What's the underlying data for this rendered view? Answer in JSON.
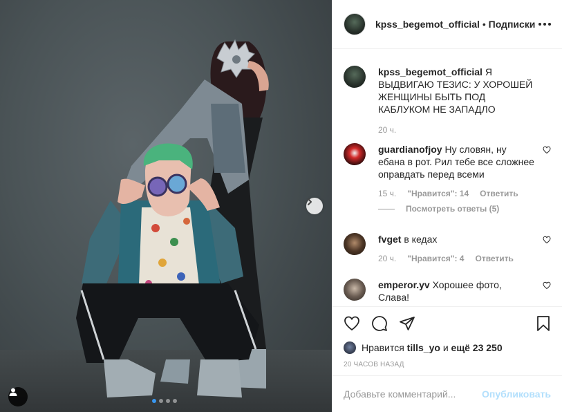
{
  "post": {
    "author": "kpss_begemot_official",
    "separator": " • ",
    "follow_label": "Подписки",
    "more_icon": "more-horizontal-icon"
  },
  "caption": {
    "username": "kpss_begemot_official",
    "text": "Я ВЫДВИГАЮ ТЕЗИС: У ХОРОШЕЙ ЖЕНЩИНЫ БЫТЬ ПОД КАБЛУКОМ НЕ ЗАПАДЛО",
    "time": "20 ч."
  },
  "comments": [
    {
      "username": "guardianofjoy",
      "text": "Ну словян, ну ебана в рот. Рил тебе все сложнее оправдать перед всеми",
      "time": "15 ч.",
      "likes": "\"Нравится\": 14",
      "reply_label": "Ответить",
      "view_replies": "Посмотреть ответы (5)"
    },
    {
      "username": "fvget",
      "text": "в кедах",
      "time": "20 ч.",
      "likes": "\"Нравится\": 4",
      "reply_label": "Ответить"
    },
    {
      "username": "emperor.yv",
      "text": "Хорошее фото, Слава!"
    }
  ],
  "likes_line": {
    "prefix": "Нравится",
    "user": "tills_yo",
    "connector": "и",
    "rest": "ещё 23 250"
  },
  "posted_ago": "20 ЧАСОВ НАЗАД",
  "add_comment": {
    "placeholder": "Добавьте комментарий...",
    "publish_label": "Опубликовать"
  },
  "carousel": {
    "slide_count": 4,
    "active_slide": 1
  },
  "colors": {
    "accent_blue": "#3897f0",
    "publish_disabled": "#b2dffc",
    "muted_text": "#999999",
    "primary_text": "#262626"
  }
}
